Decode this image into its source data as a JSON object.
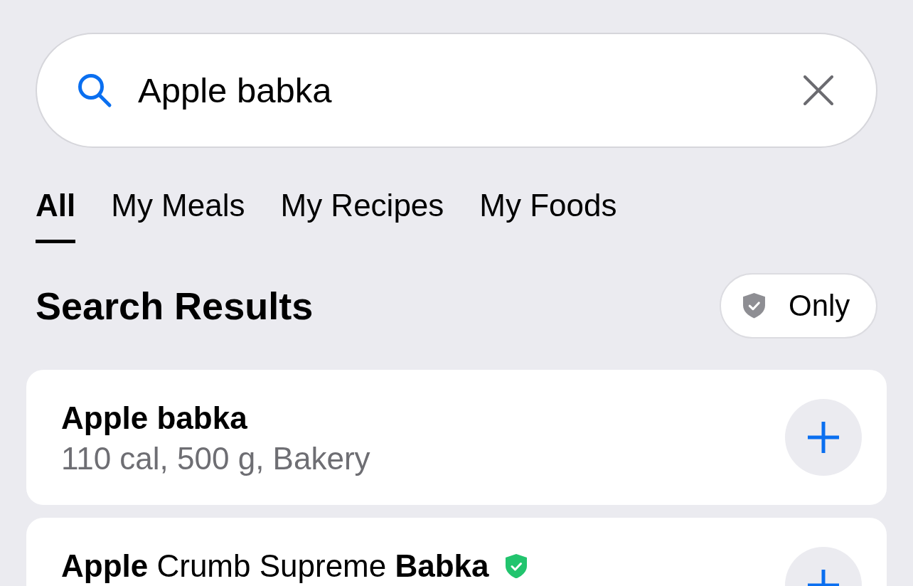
{
  "search": {
    "value": "Apple babka"
  },
  "tabs": [
    {
      "label": "All",
      "selected": true
    },
    {
      "label": "My Meals",
      "selected": false
    },
    {
      "label": "My Recipes",
      "selected": false
    },
    {
      "label": "My Foods",
      "selected": false
    }
  ],
  "results_header": {
    "title": "Search Results",
    "filter": {
      "label": "Only"
    }
  },
  "results": [
    {
      "kind": "exact",
      "title": "Apple babka",
      "details": "110 cal, 500 g, Bakery",
      "verified": false
    },
    {
      "kind": "partial",
      "title": "**Apple** Crumb Supreme **Babka**",
      "verified": true
    }
  ]
}
